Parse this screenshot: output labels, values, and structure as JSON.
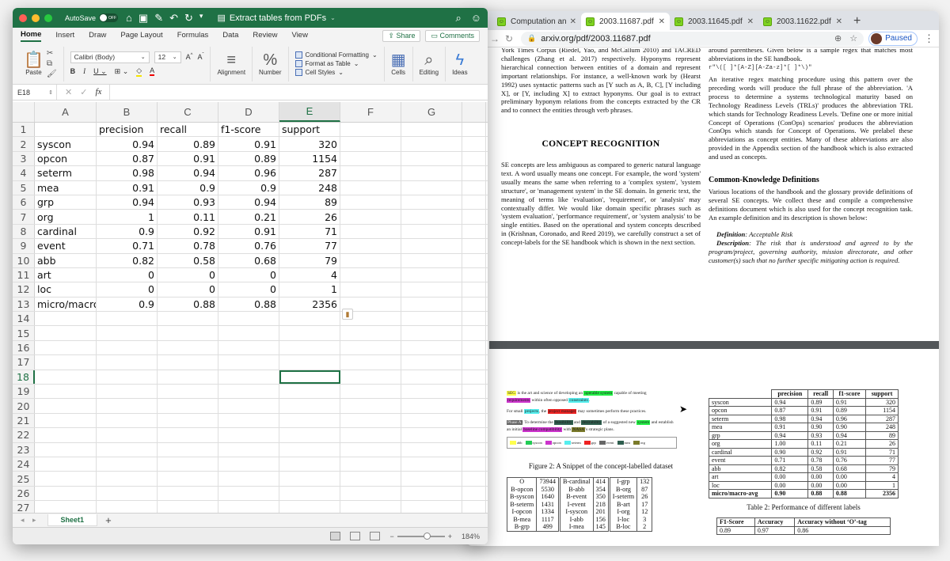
{
  "excel": {
    "title_bar": {
      "autosave_label": "AutoSave",
      "autosave_state": "OFF",
      "document_title": "Extract tables from PDFs"
    },
    "ribbon_tabs": [
      "Home",
      "Insert",
      "Draw",
      "Page Layout",
      "Formulas",
      "Data",
      "Review",
      "View"
    ],
    "active_tab": "Home",
    "share_label": "Share",
    "comments_label": "Comments",
    "ribbon": {
      "paste_label": "Paste",
      "font_name": "Calibri (Body)",
      "font_size": "12",
      "alignment_label": "Alignment",
      "number_label": "Number",
      "conditional_formatting": "Conditional Formatting",
      "format_as_table": "Format as Table",
      "cell_styles": "Cell Styles",
      "cells_label": "Cells",
      "editing_label": "Editing",
      "ideas_label": "Ideas"
    },
    "name_box": "E18",
    "formula_value": "",
    "column_headers": [
      "A",
      "B",
      "C",
      "D",
      "E",
      "F",
      "G"
    ],
    "selected_column": "E",
    "selected_row": 18,
    "rows": [
      {
        "n": "1",
        "cells": [
          "",
          "precision",
          "recall",
          "f1-score",
          "support"
        ]
      },
      {
        "n": "2",
        "cells": [
          "syscon",
          "0.94",
          "0.89",
          "0.91",
          "320"
        ]
      },
      {
        "n": "3",
        "cells": [
          "opcon",
          "0.87",
          "0.91",
          "0.89",
          "1154"
        ]
      },
      {
        "n": "4",
        "cells": [
          "seterm",
          "0.98",
          "0.94",
          "0.96",
          "287"
        ]
      },
      {
        "n": "5",
        "cells": [
          "mea",
          "0.91",
          "0.9",
          "0.9",
          "248"
        ]
      },
      {
        "n": "6",
        "cells": [
          "grp",
          "0.94",
          "0.93",
          "0.94",
          "89"
        ]
      },
      {
        "n": "7",
        "cells": [
          "org",
          "1",
          "0.11",
          "0.21",
          "26"
        ]
      },
      {
        "n": "8",
        "cells": [
          "cardinal",
          "0.9",
          "0.92",
          "0.91",
          "71"
        ]
      },
      {
        "n": "9",
        "cells": [
          "event",
          "0.71",
          "0.78",
          "0.76",
          "77"
        ]
      },
      {
        "n": "10",
        "cells": [
          "abb",
          "0.82",
          "0.58",
          "0.68",
          "79"
        ]
      },
      {
        "n": "11",
        "cells": [
          "art",
          "0",
          "0",
          "0",
          "4"
        ]
      },
      {
        "n": "12",
        "cells": [
          "loc",
          "0",
          "0",
          "0",
          "1"
        ]
      },
      {
        "n": "13",
        "cells": [
          "micro/macro",
          "0.9",
          "0.88",
          "0.88",
          "2356"
        ]
      },
      {
        "n": "14",
        "cells": [
          "",
          "",
          "",
          "",
          ""
        ]
      },
      {
        "n": "15",
        "cells": [
          "",
          "",
          "",
          "",
          ""
        ]
      },
      {
        "n": "16",
        "cells": [
          "",
          "",
          "",
          "",
          ""
        ]
      },
      {
        "n": "17",
        "cells": [
          "",
          "",
          "",
          "",
          ""
        ]
      },
      {
        "n": "18",
        "cells": [
          "",
          "",
          "",
          "",
          ""
        ]
      },
      {
        "n": "19",
        "cells": [
          "",
          "",
          "",
          "",
          ""
        ]
      },
      {
        "n": "20",
        "cells": [
          "",
          "",
          "",
          "",
          ""
        ]
      },
      {
        "n": "21",
        "cells": [
          "",
          "",
          "",
          "",
          ""
        ]
      },
      {
        "n": "22",
        "cells": [
          "",
          "",
          "",
          "",
          ""
        ]
      },
      {
        "n": "23",
        "cells": [
          "",
          "",
          "",
          "",
          ""
        ]
      },
      {
        "n": "24",
        "cells": [
          "",
          "",
          "",
          "",
          ""
        ]
      },
      {
        "n": "25",
        "cells": [
          "",
          "",
          "",
          "",
          ""
        ]
      },
      {
        "n": "26",
        "cells": [
          "",
          "",
          "",
          "",
          ""
        ]
      },
      {
        "n": "27",
        "cells": [
          "",
          "",
          "",
          "",
          ""
        ]
      }
    ],
    "sheet_tab": "Sheet1",
    "zoom_level": "184%",
    "zoom_fraction": 0.62
  },
  "browser": {
    "tabs": [
      {
        "title": "Computation and Lan",
        "active": false
      },
      {
        "title": "2003.11687.pdf",
        "active": true
      },
      {
        "title": "2003.11645.pdf",
        "active": false
      },
      {
        "title": "2003.11622.pdf",
        "active": false
      }
    ],
    "url": "arxiv.org/pdf/2003.11687.pdf",
    "profile_status": "Paused"
  },
  "pdf": {
    "left_col_top": "York Times Corpus (Riedel, Yao, and McCallum 2010) and TACRED challenges (Zhang et al. 2017) respectively. Hyponyms represent hierarchical connection between entities of a domain and represent important relationships. For instance, a well-known work by (Hearst 1992) uses syntactic patterns such as [Y such as A, B, C], [Y including X], or [Y, including X] to extract hyponyms. Our goal is to extract preliminary hyponym relations from the concepts extracted by the CR and to connect the entities through verb phrases.",
    "section_heading": "CONCEPT RECOGNITION",
    "left_col_section": "SE concepts are less ambiguous as compared to generic natural language text. A word usually means one concept. For example, the word 'system' usually means the same when referring to a 'complex system', 'system structure', or 'management system' in the SE domain. In generic text, the meaning of terms like 'evaluation', 'requirement', or 'analysis' may contextually differ. We would like domain specific phrases such as 'system evaluation', 'performance requirement', or 'system analysis' to be single entities. Based on the operational and system concepts described in (Krishnan, Coronado, and Reed 2019), we carefully construct a set of concept-labels for the SE handbook which is shown in the next section.",
    "right_col_top": "around parentheses. Given below is a sample regex that matches most abbreviations in the SE handbook.",
    "regex": "r\"\\([ ]*[A-Z][A-Za-z]*[ ]*\\)\"",
    "right_col_para": "An iterative regex matching procedure using this pattern over the preceding words will produce the full phrase of the abbreviation. 'A process to determine a systems technological maturity based on Technology Readiness Levels (TRLs)' produces the abbreviation TRL which stands for Technology Readiness Levels. 'Define one or more initial Concept of Operations (ConOps) scenarios' produces the abbreviation ConOps which stands for Concept of Operations. We prelabel these abbreviations as concept entities. Many of these abbreviations are also provided in the Appendix section of the handbook which is also extracted and used as concepts.",
    "subheading": "Common-Knowledge Definitions",
    "right_col_defs": "Various locations of the handbook and the glossary provide definitions of several SE concepts. We collect these and compile a comprehensive definitions document which is also used for the concept recognition task. An example definition and its description is shown below:",
    "definition_label": "Definition",
    "definition_value": ": Acceptable Risk",
    "description_label": "Description",
    "description_value": ": The risk that is understood and agreed to by the program/project, governing authority, mission directorate, and other customer(s) such that no further specific mitigating action is required.",
    "snippet": {
      "line1": [
        "SEG",
        " is the art and science of developing an ",
        "operable system",
        " capable of meeting ",
        "requirements",
        " within often opposed ",
        "constraints",
        "."
      ],
      "line2": [
        "For small ",
        "projects",
        ", the ",
        "project manager",
        " may sometimes perform these practices."
      ],
      "line3": [
        "Phase A",
        ": To determine the ",
        "feasibility",
        " and ",
        "desirability",
        " of a suggested new ",
        "system",
        " and establish an initial ",
        "baseline compatibility",
        " with ",
        "NASA",
        "'s strategic plans."
      ],
      "legend": [
        {
          "label": "abb",
          "color": "#ffff4d"
        },
        {
          "label": "syscon",
          "color": "#22cc55"
        },
        {
          "label": "opcon",
          "color": "#cc33cc"
        },
        {
          "label": "seterm",
          "color": "#55eeee"
        },
        {
          "label": "grp",
          "color": "#ee2222"
        },
        {
          "label": "event",
          "color": "#666666"
        },
        {
          "label": "mea",
          "color": "#2e5e4e"
        },
        {
          "label": "org",
          "color": "#7a7a2a"
        }
      ]
    },
    "figure2_caption": "Figure 2: A Snippet of the concept-labelled dataset",
    "tag_counts": [
      [
        "O",
        "73944",
        "B-cardinal",
        "414",
        "I-grp",
        "132"
      ],
      [
        "B-opcon",
        "5530",
        "B-abb",
        "354",
        "B-org",
        "87"
      ],
      [
        "B-syscon",
        "1640",
        "B-event",
        "350",
        "I-seterm",
        "26"
      ],
      [
        "B-seterm",
        "1431",
        "I-event",
        "218",
        "B-art",
        "17"
      ],
      [
        "I-opcon",
        "1334",
        "I-syscon",
        "201",
        "I-org",
        "12"
      ],
      [
        "B-mea",
        "1117",
        "I-abb",
        "156",
        "I-loc",
        "3"
      ],
      [
        "B-grp",
        "499",
        "I-mea",
        "145",
        "B-loc",
        "2"
      ]
    ],
    "table2": {
      "headers": [
        "",
        "precision",
        "recall",
        "f1-score",
        "support"
      ],
      "rows": [
        [
          "syscon",
          "0.94",
          "0.89",
          "0.91",
          "320"
        ],
        [
          "opcon",
          "0.87",
          "0.91",
          "0.89",
          "1154"
        ],
        [
          "seterm",
          "0.98",
          "0.94",
          "0.96",
          "287"
        ],
        [
          "mea",
          "0.91",
          "0.90",
          "0.90",
          "248"
        ],
        [
          "grp",
          "0.94",
          "0.93",
          "0.94",
          "89"
        ],
        [
          "org",
          "1.00",
          "0.11",
          "0.21",
          "26"
        ],
        [
          "cardinal",
          "0.90",
          "0.92",
          "0.91",
          "71"
        ],
        [
          "event",
          "0.71",
          "0.78",
          "0.76",
          "77"
        ],
        [
          "abb",
          "0.82",
          "0.58",
          "0.68",
          "79"
        ],
        [
          "art",
          "0.00",
          "0.00",
          "0.00",
          "4"
        ],
        [
          "loc",
          "0.00",
          "0.00",
          "0.00",
          "1"
        ],
        [
          "micro/macro-avg",
          "0.90",
          "0.88",
          "0.88",
          "2356"
        ]
      ],
      "caption": "Table 2: Performance of different labels"
    },
    "table3": {
      "headers": [
        "F1-Score",
        "Accuracy",
        "Accuracy without ‘O’-tag"
      ],
      "values": [
        "0.89",
        "0.97",
        "0.86"
      ]
    }
  }
}
